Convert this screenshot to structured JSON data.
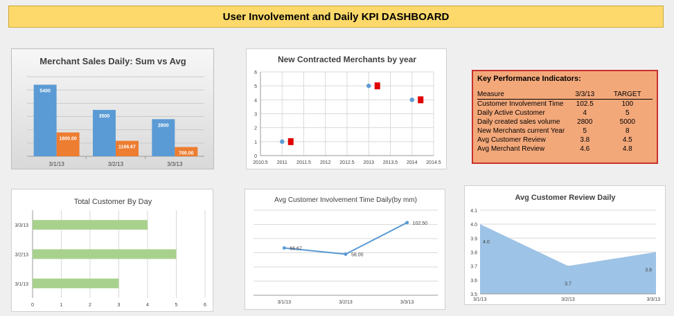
{
  "header": {
    "title": "User Involvement and Daily KPI DASHBOARD"
  },
  "kpi": {
    "title": "Key Performance Indicators:",
    "headers": [
      "Measure",
      "3/3/13",
      "TARGET"
    ],
    "rows": [
      [
        "Customer Involvement Time",
        "102.5",
        "100"
      ],
      [
        "Daily Active Customer",
        "4",
        "5"
      ],
      [
        "Daily created sales volume",
        "2800",
        "5000"
      ],
      [
        "New Merchants current Year",
        "5",
        "8"
      ],
      [
        "Avg Customer Review",
        "3.8",
        "4.5"
      ],
      [
        "Avg Merchant Review",
        "4.6",
        "4.8"
      ]
    ]
  },
  "chart_data": [
    {
      "id": "merchant-sales",
      "type": "bar",
      "title": "Merchant Sales Daily: Sum vs Avg",
      "categories": [
        "3/1/13",
        "3/2/13",
        "3/3/13"
      ],
      "series": [
        {
          "values": [
            5400,
            3500,
            2800
          ],
          "labels": [
            "5400",
            "3500",
            "2800"
          ],
          "color": "#5b9bd5"
        },
        {
          "values": [
            1800,
            1166.67,
            700
          ],
          "labels": [
            "1800.00",
            "1166.67",
            "700.00"
          ],
          "color": "#ed7d31"
        }
      ],
      "ylim": [
        0,
        6000
      ],
      "grid": true
    },
    {
      "id": "new-merchants",
      "type": "scatter",
      "title": "New Contracted Merchants by year",
      "series": [
        {
          "points": [
            [
              2011,
              1
            ],
            [
              2013,
              5
            ],
            [
              2014,
              4
            ]
          ],
          "color": "#5b9bd5",
          "marker": "circle"
        },
        {
          "points": [
            [
              2011.2,
              1
            ],
            [
              2013.2,
              5
            ],
            [
              2014.2,
              4
            ]
          ],
          "color": "#e00000",
          "marker": "square"
        }
      ],
      "xticks": [
        "2010.5",
        "2011",
        "2011.5",
        "2012",
        "2012.5",
        "2013",
        "2013.5",
        "2014",
        "2014.5"
      ],
      "yticks": [
        "0",
        "1",
        "2",
        "3",
        "4",
        "5",
        "6"
      ],
      "xlim": [
        2010.5,
        2014.5
      ],
      "ylim": [
        0,
        6
      ],
      "grid": true
    },
    {
      "id": "total-customer",
      "type": "bar",
      "orientation": "horizontal",
      "title": "Total Customer By Day",
      "categories": [
        "3/1/13",
        "3/2/13",
        "3/3/13"
      ],
      "values": [
        3,
        5,
        4
      ],
      "color": "#a9d18e",
      "xticks": [
        "0",
        "1",
        "2",
        "3",
        "4",
        "5",
        "6"
      ],
      "xlim": [
        0,
        6
      ],
      "grid": true
    },
    {
      "id": "involvement-time",
      "type": "line",
      "title": "Avg Customer Involvement Time Daily(by mm)",
      "categories": [
        "3/1/13",
        "3/2/13",
        "3/3/13"
      ],
      "values": [
        66.67,
        58.0,
        102.5
      ],
      "labels": [
        "66.67",
        "58.00",
        "102.50"
      ],
      "color": "#5b9bd5",
      "ylim": [
        0,
        120
      ],
      "grid": true
    },
    {
      "id": "customer-review",
      "type": "area",
      "title": "Avg Customer Review Daily",
      "categories": [
        "3/1/13",
        "3/2/13",
        "3/3/13"
      ],
      "values": [
        4.0,
        3.7,
        3.8
      ],
      "labels": [
        "4.0",
        "3.7",
        "3.8"
      ],
      "color": "#9dc3e6",
      "yticks": [
        "3.5",
        "3.6",
        "3.7",
        "3.8",
        "3.9",
        "4.0",
        "4.1"
      ],
      "ylim": [
        3.5,
        4.1
      ],
      "grid": true
    }
  ]
}
